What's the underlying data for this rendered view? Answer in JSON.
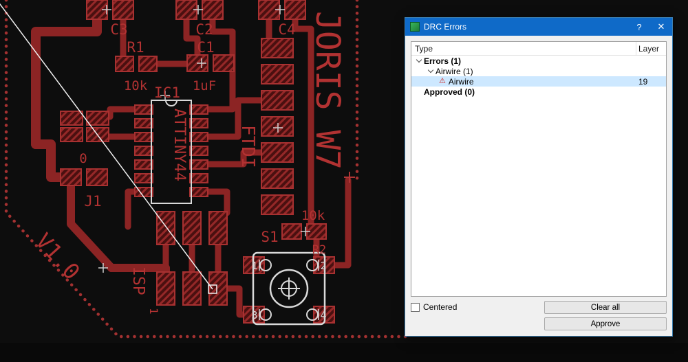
{
  "dialog": {
    "title": "DRC Errors",
    "help_label": "?",
    "close_label": "✕",
    "columns": {
      "type": "Type",
      "layer": "Layer"
    },
    "tree": {
      "errors_group": "Errors (1)",
      "airwire_group": "Airwire (1)",
      "airwire_item": "Airwire",
      "airwire_layer": "19",
      "approved_group": "Approved (0)"
    },
    "centered_label": "Centered",
    "buttons": {
      "clear_all": "Clear all",
      "approve": "Approve"
    },
    "icons": {
      "warning_glyph": "⚠"
    },
    "colors": {
      "titlebar": "#0f6ac8",
      "selection": "#cde8ff"
    }
  },
  "pcb": {
    "colors": {
      "background": "#0d0d0d",
      "copper": "#8c2424",
      "copper_outline": "#a83131",
      "silkscreen": "#d9d9d9",
      "label": "#b23232"
    },
    "labels": {
      "c3": "C3",
      "c2": "C2",
      "c4": "C4",
      "r1": "R1",
      "c1": "C1",
      "r1_value": "10k",
      "c1_value": "1uF",
      "ic1": "IC1",
      "ic1_part": "ATTINY44",
      "ftdi": "FTDI",
      "board_name": "JORIS W7",
      "r0": "0",
      "j1": "J1",
      "version": "V1.0",
      "isp": "ISP",
      "isp_pin1": "1",
      "s1": "S1",
      "r2": "R2",
      "r2_value": "10k",
      "sw_pin1": "1",
      "sw_pin2": "2",
      "sw_pin3": "3",
      "sw_pin4": "4"
    }
  }
}
